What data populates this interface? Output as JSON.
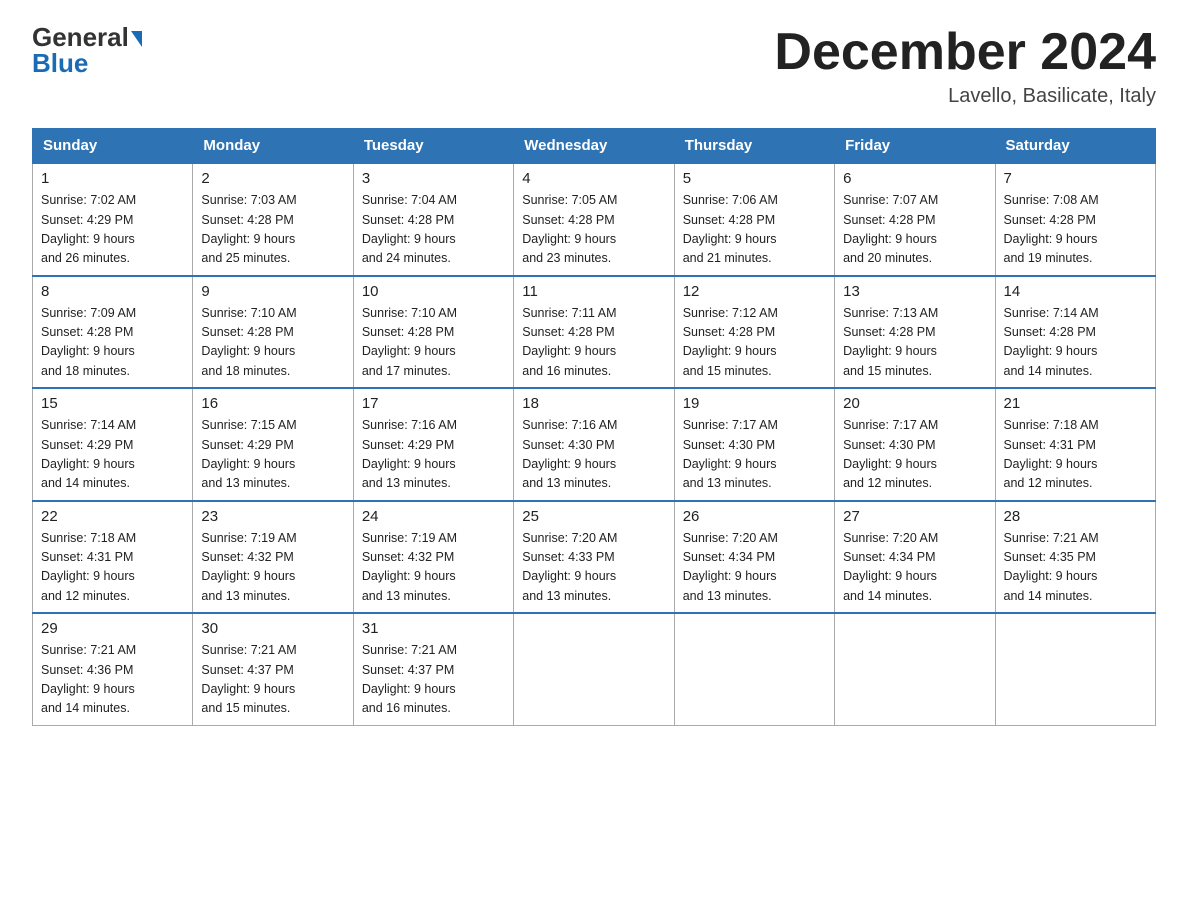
{
  "header": {
    "logo_general": "General",
    "logo_blue": "Blue",
    "title": "December 2024",
    "subtitle": "Lavello, Basilicate, Italy"
  },
  "days_of_week": [
    "Sunday",
    "Monday",
    "Tuesday",
    "Wednesday",
    "Thursday",
    "Friday",
    "Saturday"
  ],
  "weeks": [
    [
      {
        "day": "1",
        "sunrise": "7:02 AM",
        "sunset": "4:29 PM",
        "daylight": "9 hours and 26 minutes."
      },
      {
        "day": "2",
        "sunrise": "7:03 AM",
        "sunset": "4:28 PM",
        "daylight": "9 hours and 25 minutes."
      },
      {
        "day": "3",
        "sunrise": "7:04 AM",
        "sunset": "4:28 PM",
        "daylight": "9 hours and 24 minutes."
      },
      {
        "day": "4",
        "sunrise": "7:05 AM",
        "sunset": "4:28 PM",
        "daylight": "9 hours and 23 minutes."
      },
      {
        "day": "5",
        "sunrise": "7:06 AM",
        "sunset": "4:28 PM",
        "daylight": "9 hours and 21 minutes."
      },
      {
        "day": "6",
        "sunrise": "7:07 AM",
        "sunset": "4:28 PM",
        "daylight": "9 hours and 20 minutes."
      },
      {
        "day": "7",
        "sunrise": "7:08 AM",
        "sunset": "4:28 PM",
        "daylight": "9 hours and 19 minutes."
      }
    ],
    [
      {
        "day": "8",
        "sunrise": "7:09 AM",
        "sunset": "4:28 PM",
        "daylight": "9 hours and 18 minutes."
      },
      {
        "day": "9",
        "sunrise": "7:10 AM",
        "sunset": "4:28 PM",
        "daylight": "9 hours and 18 minutes."
      },
      {
        "day": "10",
        "sunrise": "7:10 AM",
        "sunset": "4:28 PM",
        "daylight": "9 hours and 17 minutes."
      },
      {
        "day": "11",
        "sunrise": "7:11 AM",
        "sunset": "4:28 PM",
        "daylight": "9 hours and 16 minutes."
      },
      {
        "day": "12",
        "sunrise": "7:12 AM",
        "sunset": "4:28 PM",
        "daylight": "9 hours and 15 minutes."
      },
      {
        "day": "13",
        "sunrise": "7:13 AM",
        "sunset": "4:28 PM",
        "daylight": "9 hours and 15 minutes."
      },
      {
        "day": "14",
        "sunrise": "7:14 AM",
        "sunset": "4:28 PM",
        "daylight": "9 hours and 14 minutes."
      }
    ],
    [
      {
        "day": "15",
        "sunrise": "7:14 AM",
        "sunset": "4:29 PM",
        "daylight": "9 hours and 14 minutes."
      },
      {
        "day": "16",
        "sunrise": "7:15 AM",
        "sunset": "4:29 PM",
        "daylight": "9 hours and 13 minutes."
      },
      {
        "day": "17",
        "sunrise": "7:16 AM",
        "sunset": "4:29 PM",
        "daylight": "9 hours and 13 minutes."
      },
      {
        "day": "18",
        "sunrise": "7:16 AM",
        "sunset": "4:30 PM",
        "daylight": "9 hours and 13 minutes."
      },
      {
        "day": "19",
        "sunrise": "7:17 AM",
        "sunset": "4:30 PM",
        "daylight": "9 hours and 13 minutes."
      },
      {
        "day": "20",
        "sunrise": "7:17 AM",
        "sunset": "4:30 PM",
        "daylight": "9 hours and 12 minutes."
      },
      {
        "day": "21",
        "sunrise": "7:18 AM",
        "sunset": "4:31 PM",
        "daylight": "9 hours and 12 minutes."
      }
    ],
    [
      {
        "day": "22",
        "sunrise": "7:18 AM",
        "sunset": "4:31 PM",
        "daylight": "9 hours and 12 minutes."
      },
      {
        "day": "23",
        "sunrise": "7:19 AM",
        "sunset": "4:32 PM",
        "daylight": "9 hours and 13 minutes."
      },
      {
        "day": "24",
        "sunrise": "7:19 AM",
        "sunset": "4:32 PM",
        "daylight": "9 hours and 13 minutes."
      },
      {
        "day": "25",
        "sunrise": "7:20 AM",
        "sunset": "4:33 PM",
        "daylight": "9 hours and 13 minutes."
      },
      {
        "day": "26",
        "sunrise": "7:20 AM",
        "sunset": "4:34 PM",
        "daylight": "9 hours and 13 minutes."
      },
      {
        "day": "27",
        "sunrise": "7:20 AM",
        "sunset": "4:34 PM",
        "daylight": "9 hours and 14 minutes."
      },
      {
        "day": "28",
        "sunrise": "7:21 AM",
        "sunset": "4:35 PM",
        "daylight": "9 hours and 14 minutes."
      }
    ],
    [
      {
        "day": "29",
        "sunrise": "7:21 AM",
        "sunset": "4:36 PM",
        "daylight": "9 hours and 14 minutes."
      },
      {
        "day": "30",
        "sunrise": "7:21 AM",
        "sunset": "4:37 PM",
        "daylight": "9 hours and 15 minutes."
      },
      {
        "day": "31",
        "sunrise": "7:21 AM",
        "sunset": "4:37 PM",
        "daylight": "9 hours and 16 minutes."
      },
      null,
      null,
      null,
      null
    ]
  ]
}
